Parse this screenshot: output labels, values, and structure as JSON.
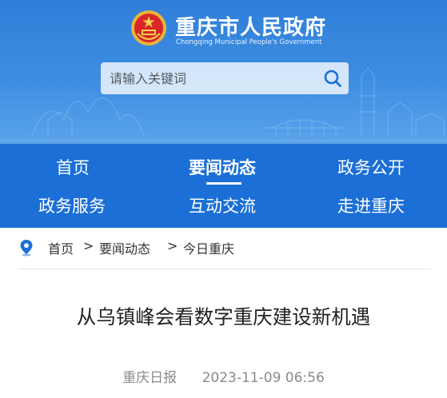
{
  "header": {
    "title": "重庆市人民政府",
    "subtitle": "Chongqing Municipal People's Government",
    "search_placeholder": "请输入关键词",
    "search_value": "",
    "colors": {
      "header": "#3585dc",
      "nav": "#1b6fd6"
    }
  },
  "nav": {
    "items": [
      {
        "label": "首页"
      },
      {
        "label": "要闻动态"
      },
      {
        "label": "政务公开"
      },
      {
        "label": "政务服务"
      },
      {
        "label": "互动交流"
      },
      {
        "label": "走进重庆"
      }
    ]
  },
  "breadcrumb": {
    "home": "首页",
    "sep1": ">",
    "section": "要闻动态",
    "sep2": ">",
    "current": "今日重庆"
  },
  "article": {
    "title": "从乌镇峰会看数字重庆建设新机遇",
    "source": "重庆日报",
    "datetime": "2023-11-09 06:56"
  }
}
